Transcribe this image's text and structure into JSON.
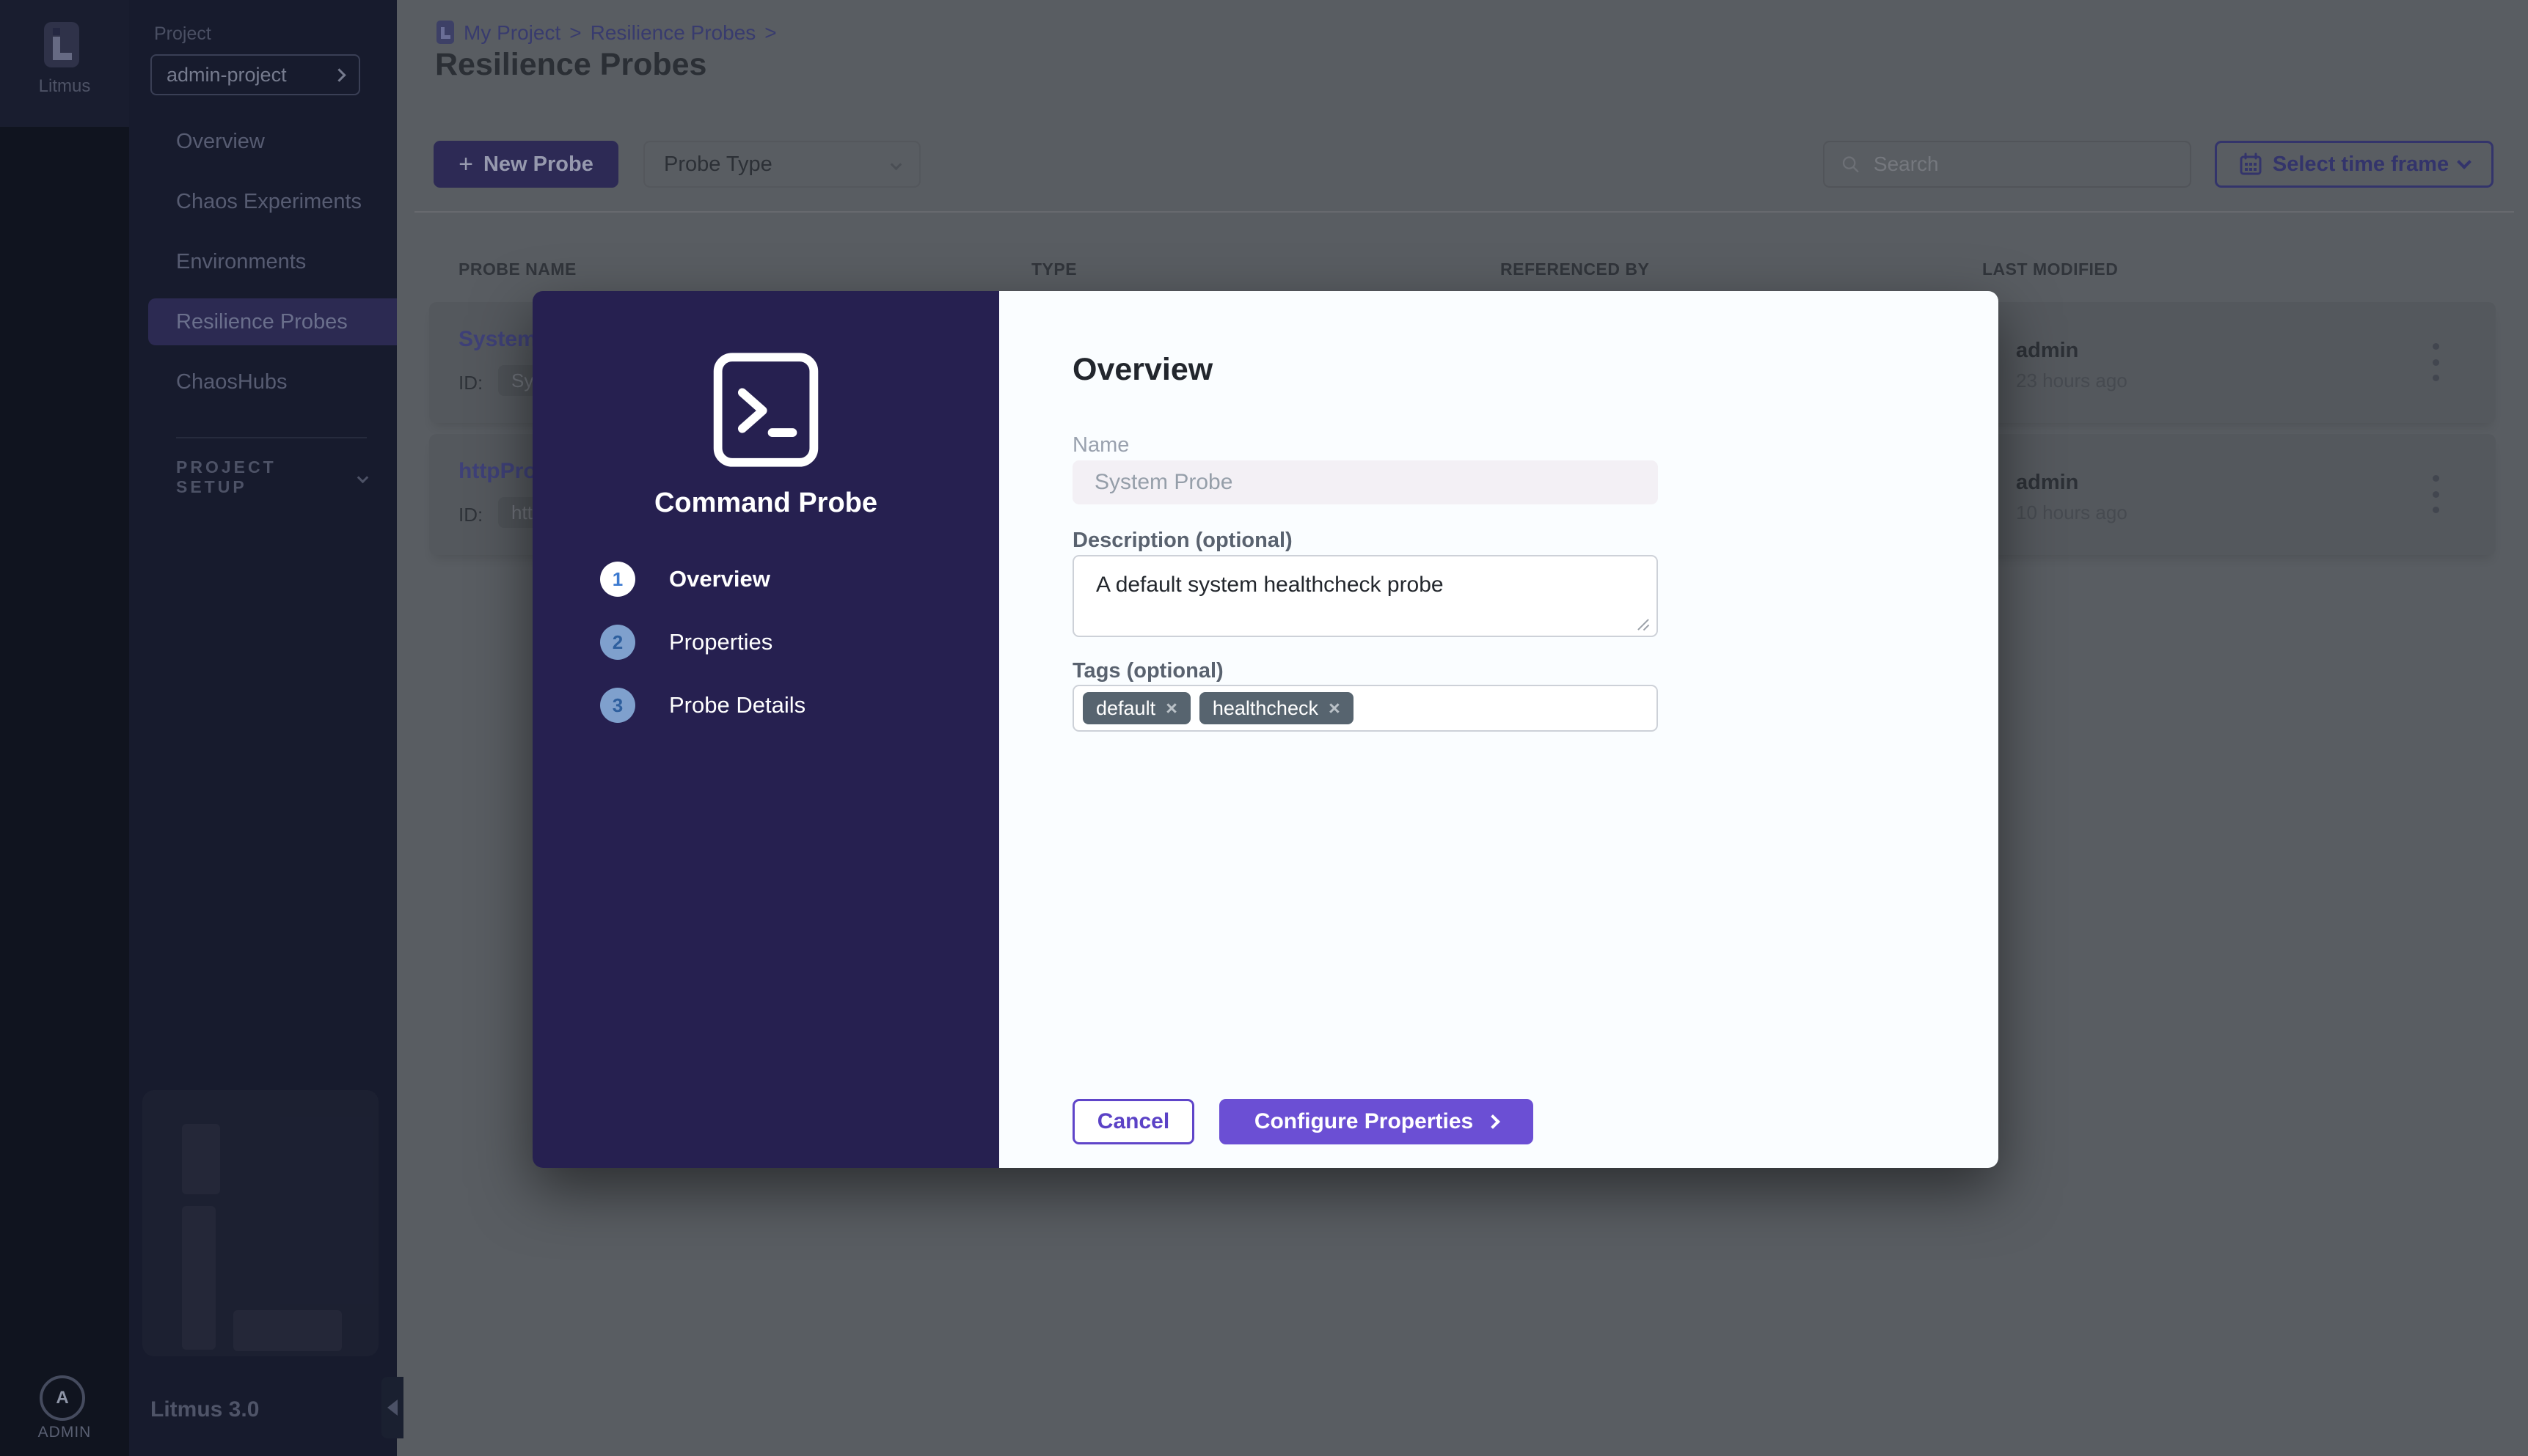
{
  "rail": {
    "logo_text": "Litmus",
    "user_initial": "A",
    "user_label": "ADMIN"
  },
  "sidebar": {
    "project_label": "Project",
    "project_value": "admin-project",
    "nav": [
      {
        "label": "Overview"
      },
      {
        "label": "Chaos Experiments"
      },
      {
        "label": "Environments"
      },
      {
        "label": "Resilience Probes"
      },
      {
        "label": "ChaosHubs"
      }
    ],
    "section_label": "PROJECT SETUP",
    "version": "Litmus 3.0"
  },
  "breadcrumb": {
    "items": [
      "My Project",
      "Resilience Probes"
    ],
    "separator": ">"
  },
  "page": {
    "title": "Resilience Probes"
  },
  "toolbar": {
    "plus_icon": "+",
    "new_probe": "New Probe",
    "probe_type": "Probe Type",
    "search_placeholder": "Search",
    "time_frame": "Select time frame"
  },
  "table": {
    "headers": [
      "PROBE NAME",
      "TYPE",
      "REFERENCED BY",
      "LAST MODIFIED"
    ],
    "rows": [
      {
        "name": "System",
        "id_label": "ID:",
        "id_value": "Syst",
        "modified_by": "admin",
        "modified_time": "23 hours ago"
      },
      {
        "name": "httpPro",
        "id_label": "ID:",
        "id_value": "http",
        "modified_by": "admin",
        "modified_time": "10 hours ago"
      }
    ]
  },
  "modal": {
    "type_title": "Command Probe",
    "steps": [
      {
        "number": "1",
        "label": "Overview"
      },
      {
        "number": "2",
        "label": "Properties"
      },
      {
        "number": "3",
        "label": "Probe Details"
      }
    ],
    "heading": "Overview",
    "name_label": "Name",
    "name_value": "System Probe",
    "description_label": "Description (optional)",
    "description_value": "A default system healthcheck probe",
    "tags_label": "Tags (optional)",
    "tags": [
      {
        "text": "default"
      },
      {
        "text": "healthcheck"
      }
    ],
    "chip_close": "×",
    "cancel": "Cancel",
    "next": "Configure Properties"
  },
  "colors": {
    "accent_purple": "#6b4fd4",
    "modal_panel": "#262050",
    "sidebar": "#171b2d",
    "chip_slate": "#57646f",
    "step_inactive": "#7fa0cd"
  }
}
